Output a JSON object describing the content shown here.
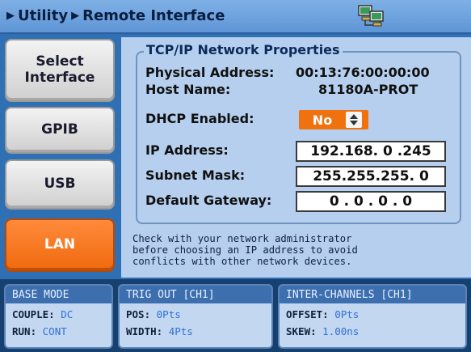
{
  "header": {
    "crumbs": [
      "Utility",
      "Remote Interface"
    ]
  },
  "sidebar": {
    "buttons": [
      {
        "label_line1": "Select",
        "label_line2": "Interface"
      },
      {
        "label": "GPIB"
      },
      {
        "label": "USB"
      },
      {
        "label": "LAN",
        "active": true
      }
    ]
  },
  "network": {
    "group_title": "TCP/IP Network Properties",
    "physical_address_label": "Physical Address:",
    "physical_address": "00:13:76:00:00:00",
    "host_name_label": "Host Name:",
    "host_name": "81180A-PROT",
    "dhcp_label": "DHCP Enabled:",
    "dhcp_value": "No",
    "ip_label": "IP Address:",
    "ip_value": "192.168. 0 .245",
    "subnet_label": "Subnet Mask:",
    "subnet_value": "255.255.255. 0",
    "gateway_label": "Default Gateway:",
    "gateway_value": "0 . 0 . 0 . 0"
  },
  "note": {
    "line1": "Check with your network administrator",
    "line2": "before choosing an IP address to avoid",
    "line3": "conflicts with other network devices."
  },
  "status": {
    "base_mode": {
      "title": "BASE MODE",
      "couple_label": "COUPLE:",
      "couple_value": "DC",
      "run_label": "RUN:",
      "run_value": "CONT"
    },
    "trig_out": {
      "title": "TRIG OUT [CH1]",
      "pos_label": "POS:",
      "pos_value": "0Pts",
      "width_label": "WIDTH:",
      "width_value": "4Pts"
    },
    "inter_channels": {
      "title": "INTER-CHANNELS [CH1]",
      "offset_label": "OFFSET:",
      "offset_value": "0Pts",
      "skew_label": "SKEW:",
      "skew_value": "1.00ns"
    }
  },
  "colors": {
    "active_button": "#f06a10",
    "panel_bg": "#b6cfee",
    "status_value": "#2f6fd6"
  },
  "icons": {
    "header": "network-computers-icon",
    "crumb": "triangle-right-icon",
    "spinner": "up-down-arrows-icon"
  }
}
